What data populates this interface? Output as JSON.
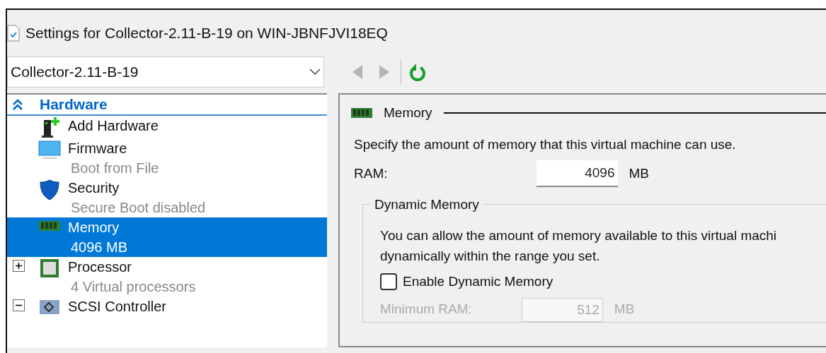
{
  "window": {
    "title": "Settings for Collector-2.11-B-19 on WIN-JBNFJVI18EQ"
  },
  "vm_selector": {
    "value": "Collector-2.11-B-19"
  },
  "toolbar": [
    {
      "kind": "back",
      "disabled": true
    },
    {
      "kind": "forward",
      "disabled": true
    },
    {
      "kind": "refresh",
      "disabled": false
    }
  ],
  "sidebar": {
    "section": {
      "label": "Hardware",
      "expanded": true
    },
    "items": [
      {
        "kind": "add-hardware",
        "label": "Add Hardware",
        "selected": false
      },
      {
        "kind": "firmware",
        "label": "Firmware",
        "detail": "Boot from File",
        "selected": false
      },
      {
        "kind": "security",
        "label": "Security",
        "detail": "Secure Boot disabled",
        "selected": false
      },
      {
        "kind": "memory",
        "label": "Memory",
        "detail": "4096 MB",
        "selected": true
      },
      {
        "kind": "processor",
        "label": "Processor",
        "detail": "4 Virtual processors",
        "selected": false,
        "expanded": false
      },
      {
        "kind": "scsi",
        "label": "SCSI Controller",
        "selected": false,
        "expanded": true
      }
    ]
  },
  "panel": {
    "title": "Memory",
    "description": "Specify the amount of memory that this virtual machine can use.",
    "ram": {
      "label": "RAM:",
      "value": "4096",
      "unit": "MB"
    },
    "dynamic_memory": {
      "title": "Dynamic Memory",
      "description": "You can allow the amount of memory available to this virtual machi",
      "description_2": "dynamically within the range you set.",
      "enable": {
        "label": "Enable Dynamic Memory",
        "checked": false
      },
      "minimum_ram": {
        "label": "Minimum RAM:",
        "value": "512",
        "unit": "MB",
        "disabled": true
      }
    }
  }
}
